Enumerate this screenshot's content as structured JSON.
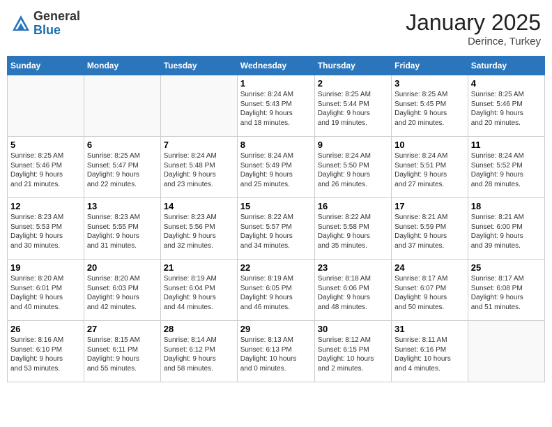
{
  "header": {
    "logo_general": "General",
    "logo_blue": "Blue",
    "month_title": "January 2025",
    "location": "Derince, Turkey"
  },
  "weekdays": [
    "Sunday",
    "Monday",
    "Tuesday",
    "Wednesday",
    "Thursday",
    "Friday",
    "Saturday"
  ],
  "days": [
    {
      "num": "",
      "info": ""
    },
    {
      "num": "",
      "info": ""
    },
    {
      "num": "",
      "info": ""
    },
    {
      "num": "1",
      "info": "Sunrise: 8:24 AM\nSunset: 5:43 PM\nDaylight: 9 hours\nand 18 minutes."
    },
    {
      "num": "2",
      "info": "Sunrise: 8:25 AM\nSunset: 5:44 PM\nDaylight: 9 hours\nand 19 minutes."
    },
    {
      "num": "3",
      "info": "Sunrise: 8:25 AM\nSunset: 5:45 PM\nDaylight: 9 hours\nand 20 minutes."
    },
    {
      "num": "4",
      "info": "Sunrise: 8:25 AM\nSunset: 5:46 PM\nDaylight: 9 hours\nand 20 minutes."
    },
    {
      "num": "5",
      "info": "Sunrise: 8:25 AM\nSunset: 5:46 PM\nDaylight: 9 hours\nand 21 minutes."
    },
    {
      "num": "6",
      "info": "Sunrise: 8:25 AM\nSunset: 5:47 PM\nDaylight: 9 hours\nand 22 minutes."
    },
    {
      "num": "7",
      "info": "Sunrise: 8:24 AM\nSunset: 5:48 PM\nDaylight: 9 hours\nand 23 minutes."
    },
    {
      "num": "8",
      "info": "Sunrise: 8:24 AM\nSunset: 5:49 PM\nDaylight: 9 hours\nand 25 minutes."
    },
    {
      "num": "9",
      "info": "Sunrise: 8:24 AM\nSunset: 5:50 PM\nDaylight: 9 hours\nand 26 minutes."
    },
    {
      "num": "10",
      "info": "Sunrise: 8:24 AM\nSunset: 5:51 PM\nDaylight: 9 hours\nand 27 minutes."
    },
    {
      "num": "11",
      "info": "Sunrise: 8:24 AM\nSunset: 5:52 PM\nDaylight: 9 hours\nand 28 minutes."
    },
    {
      "num": "12",
      "info": "Sunrise: 8:23 AM\nSunset: 5:53 PM\nDaylight: 9 hours\nand 30 minutes."
    },
    {
      "num": "13",
      "info": "Sunrise: 8:23 AM\nSunset: 5:55 PM\nDaylight: 9 hours\nand 31 minutes."
    },
    {
      "num": "14",
      "info": "Sunrise: 8:23 AM\nSunset: 5:56 PM\nDaylight: 9 hours\nand 32 minutes."
    },
    {
      "num": "15",
      "info": "Sunrise: 8:22 AM\nSunset: 5:57 PM\nDaylight: 9 hours\nand 34 minutes."
    },
    {
      "num": "16",
      "info": "Sunrise: 8:22 AM\nSunset: 5:58 PM\nDaylight: 9 hours\nand 35 minutes."
    },
    {
      "num": "17",
      "info": "Sunrise: 8:21 AM\nSunset: 5:59 PM\nDaylight: 9 hours\nand 37 minutes."
    },
    {
      "num": "18",
      "info": "Sunrise: 8:21 AM\nSunset: 6:00 PM\nDaylight: 9 hours\nand 39 minutes."
    },
    {
      "num": "19",
      "info": "Sunrise: 8:20 AM\nSunset: 6:01 PM\nDaylight: 9 hours\nand 40 minutes."
    },
    {
      "num": "20",
      "info": "Sunrise: 8:20 AM\nSunset: 6:03 PM\nDaylight: 9 hours\nand 42 minutes."
    },
    {
      "num": "21",
      "info": "Sunrise: 8:19 AM\nSunset: 6:04 PM\nDaylight: 9 hours\nand 44 minutes."
    },
    {
      "num": "22",
      "info": "Sunrise: 8:19 AM\nSunset: 6:05 PM\nDaylight: 9 hours\nand 46 minutes."
    },
    {
      "num": "23",
      "info": "Sunrise: 8:18 AM\nSunset: 6:06 PM\nDaylight: 9 hours\nand 48 minutes."
    },
    {
      "num": "24",
      "info": "Sunrise: 8:17 AM\nSunset: 6:07 PM\nDaylight: 9 hours\nand 50 minutes."
    },
    {
      "num": "25",
      "info": "Sunrise: 8:17 AM\nSunset: 6:08 PM\nDaylight: 9 hours\nand 51 minutes."
    },
    {
      "num": "26",
      "info": "Sunrise: 8:16 AM\nSunset: 6:10 PM\nDaylight: 9 hours\nand 53 minutes."
    },
    {
      "num": "27",
      "info": "Sunrise: 8:15 AM\nSunset: 6:11 PM\nDaylight: 9 hours\nand 55 minutes."
    },
    {
      "num": "28",
      "info": "Sunrise: 8:14 AM\nSunset: 6:12 PM\nDaylight: 9 hours\nand 58 minutes."
    },
    {
      "num": "29",
      "info": "Sunrise: 8:13 AM\nSunset: 6:13 PM\nDaylight: 10 hours\nand 0 minutes."
    },
    {
      "num": "30",
      "info": "Sunrise: 8:12 AM\nSunset: 6:15 PM\nDaylight: 10 hours\nand 2 minutes."
    },
    {
      "num": "31",
      "info": "Sunrise: 8:11 AM\nSunset: 6:16 PM\nDaylight: 10 hours\nand 4 minutes."
    },
    {
      "num": "",
      "info": ""
    }
  ]
}
